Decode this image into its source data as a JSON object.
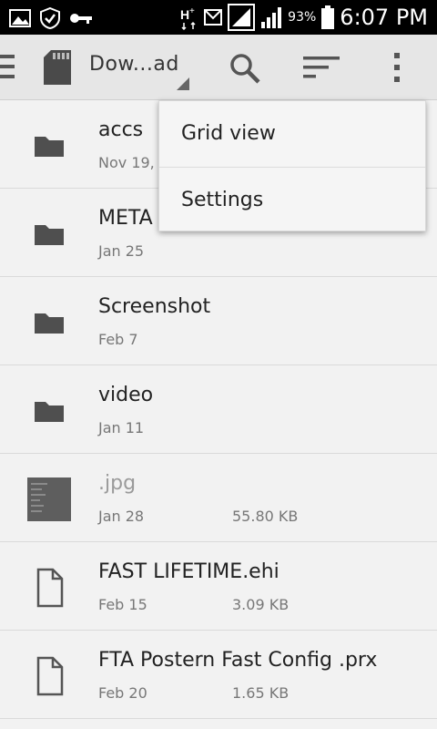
{
  "status_bar": {
    "battery": "93%",
    "time": "6:07 PM",
    "left_icons": [
      "image-icon",
      "shield-icon",
      "key-icon"
    ],
    "right_icons": [
      "data-h-plus-icon",
      "message-icon",
      "signal-icon",
      "signal-icon",
      "battery-icon"
    ]
  },
  "app_bar": {
    "title": "Dow...ad",
    "icons": [
      "menu-icon",
      "sd-card-icon",
      "search-icon",
      "sort-icon",
      "overflow-icon"
    ]
  },
  "popup_menu": {
    "items": [
      {
        "label": "Grid view"
      },
      {
        "label": "Settings"
      }
    ]
  },
  "files": [
    {
      "name": "accs",
      "date": "Nov 19,",
      "size": "",
      "type": "folder"
    },
    {
      "name": "META",
      "date": "Jan 25",
      "size": "",
      "type": "folder"
    },
    {
      "name": "Screenshot",
      "date": "Feb 7",
      "size": "",
      "type": "folder"
    },
    {
      "name": "video",
      "date": "Jan 11",
      "size": "",
      "type": "folder"
    },
    {
      "name": ".jpg",
      "date": "Jan 28",
      "size": "55.80 KB",
      "type": "image"
    },
    {
      "name": "FAST LIFETIME.ehi",
      "date": "Feb 15",
      "size": "3.09 KB",
      "type": "file"
    },
    {
      "name": "FTA Postern Fast Config .prx",
      "date": "Feb 20",
      "size": "1.65 KB",
      "type": "file"
    }
  ]
}
